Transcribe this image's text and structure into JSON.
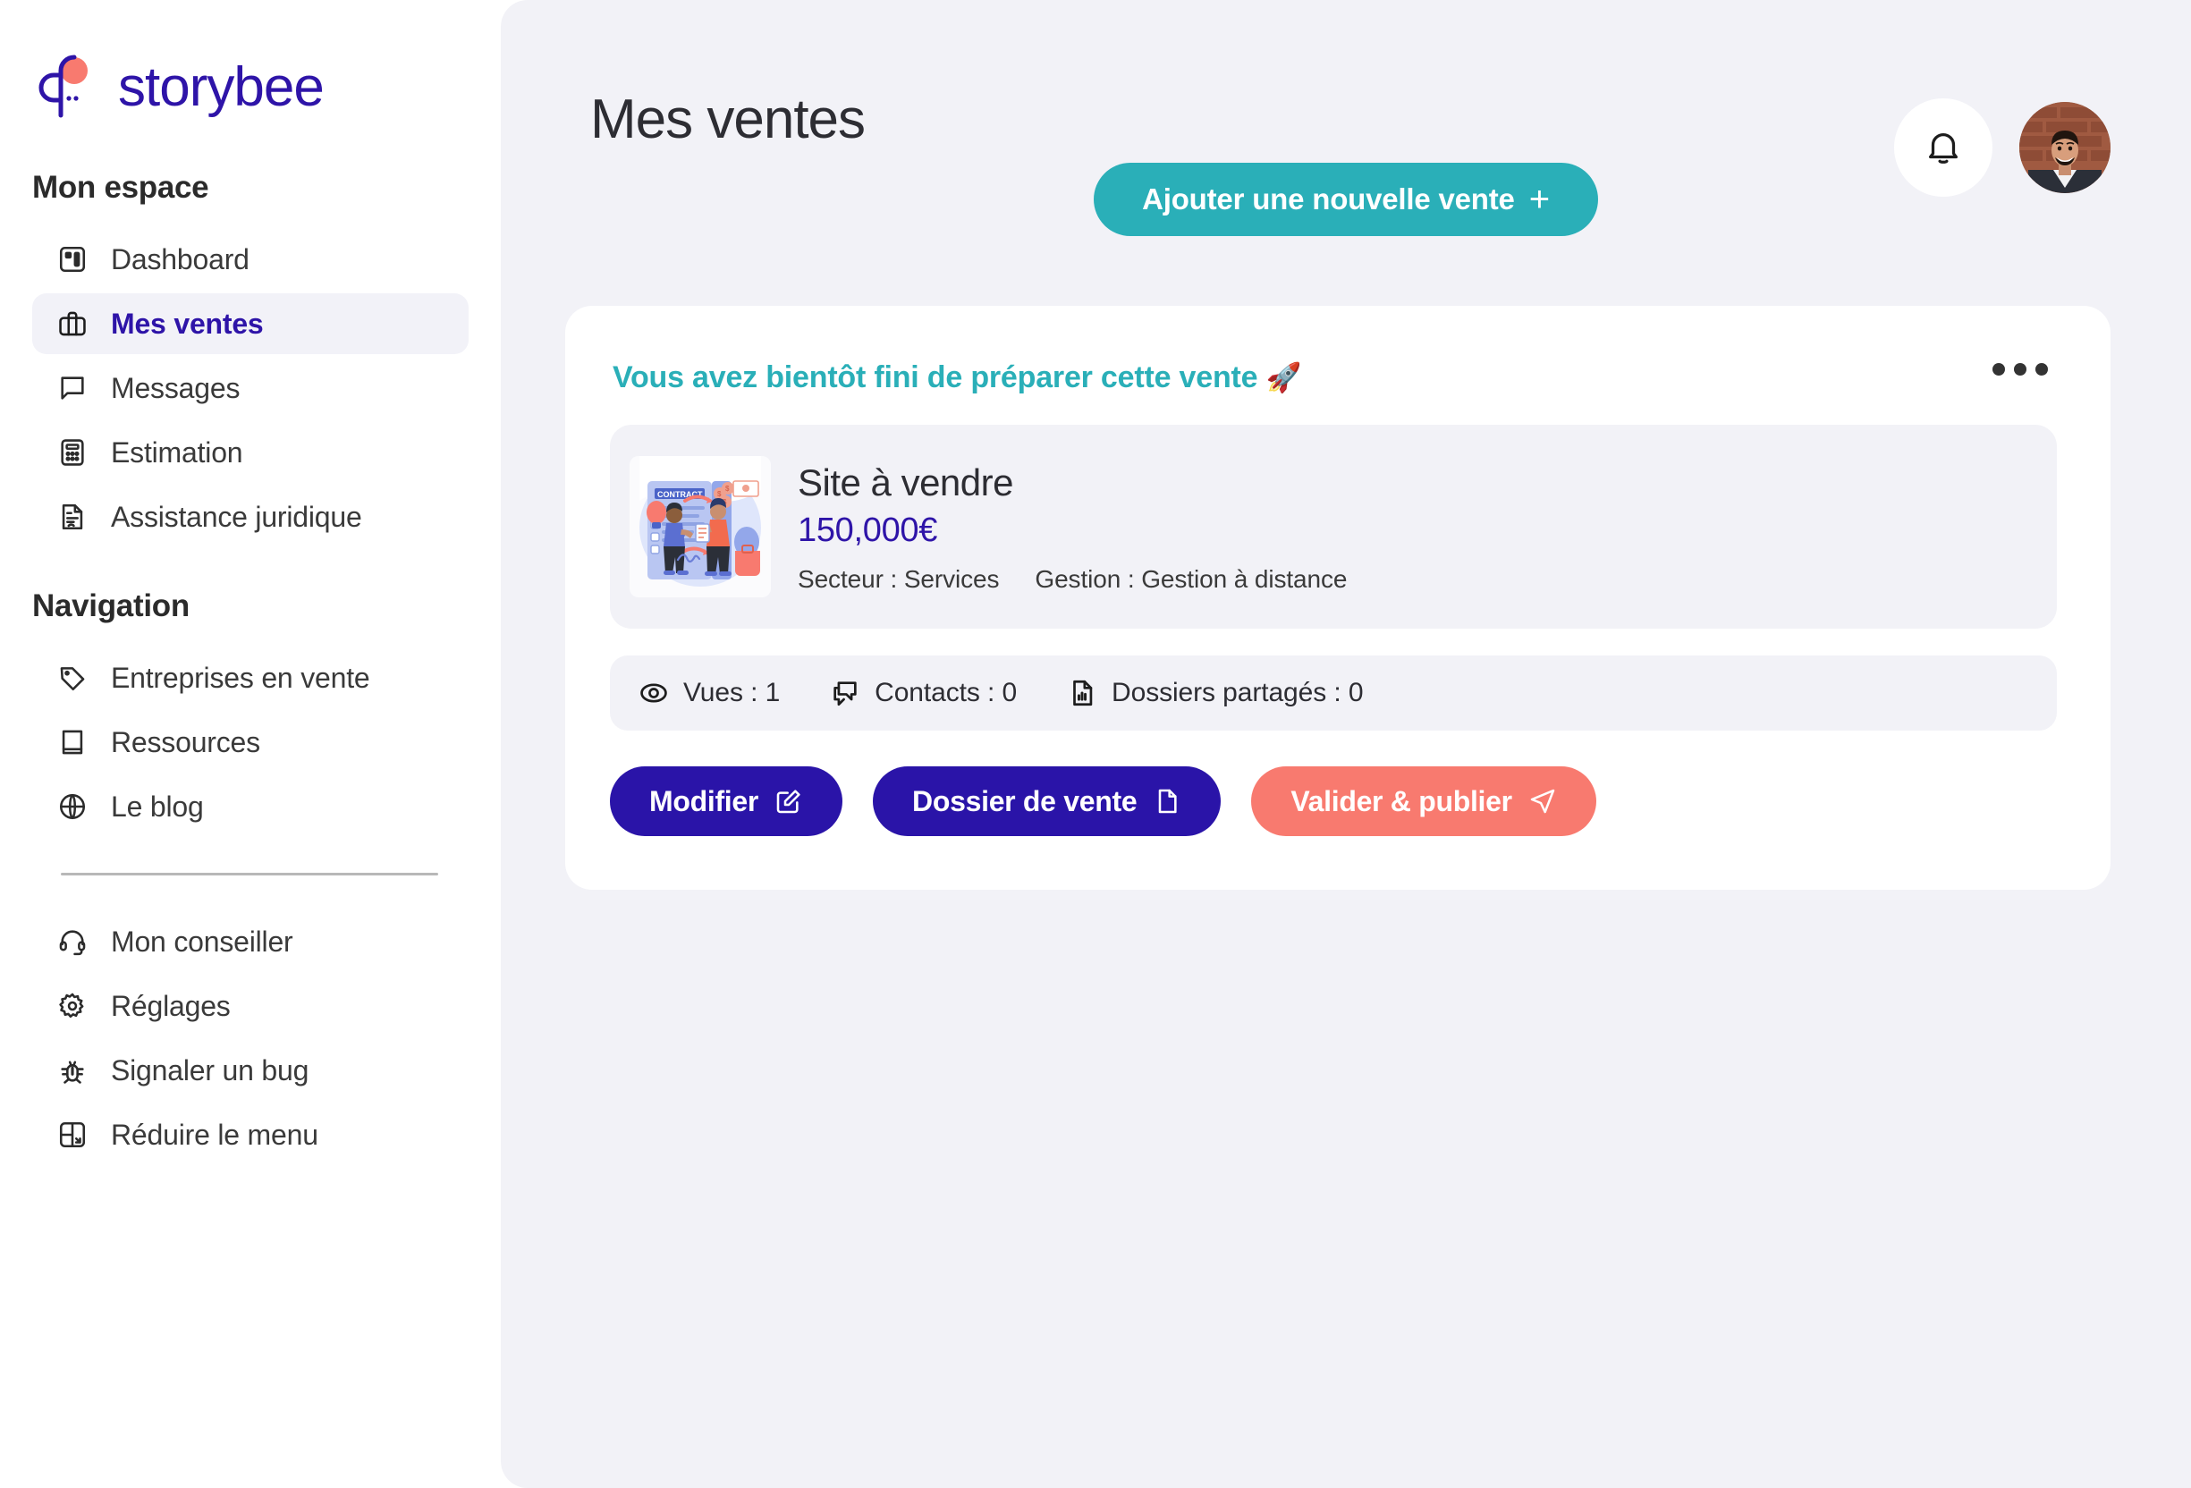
{
  "brand": {
    "name": "storybee",
    "logo_icon": "storybee-logo-icon",
    "accent_purple": "#2e14a8",
    "accent_coral": "#f87a6f",
    "accent_teal": "#2aafb8"
  },
  "sidebar": {
    "sections": [
      {
        "title": "Mon espace",
        "items": [
          {
            "label": "Dashboard",
            "icon": "dashboard-icon",
            "active": false
          },
          {
            "label": "Mes ventes",
            "icon": "briefcase-icon",
            "active": true
          },
          {
            "label": "Messages",
            "icon": "chat-bubble-icon",
            "active": false
          },
          {
            "label": "Estimation",
            "icon": "calculator-icon",
            "active": false
          },
          {
            "label": "Assistance juridique",
            "icon": "legal-document-icon",
            "active": false
          }
        ]
      },
      {
        "title": "Navigation",
        "items": [
          {
            "label": "Entreprises en vente",
            "icon": "tag-icon",
            "active": false
          },
          {
            "label": "Ressources",
            "icon": "book-icon",
            "active": false
          },
          {
            "label": "Le blog",
            "icon": "globe-icon",
            "active": false
          }
        ]
      }
    ],
    "bottom_items": [
      {
        "label": "Mon conseiller",
        "icon": "headset-icon"
      },
      {
        "label": "Réglages",
        "icon": "gear-icon"
      },
      {
        "label": "Signaler un bug",
        "icon": "bug-icon"
      },
      {
        "label": "Réduire le menu",
        "icon": "collapse-menu-icon"
      }
    ]
  },
  "header": {
    "page_title": "Mes ventes",
    "bell_icon": "notification-bell-icon",
    "avatar_icon": "user-avatar"
  },
  "actions_top": {
    "add_sale_label": "Ajouter une nouvelle vente",
    "add_sale_plus": "+"
  },
  "card": {
    "status_message": "Vous avez bientôt fini de préparer cette vente",
    "status_emoji": "🚀",
    "kebab_icon": "more-options-icon",
    "listing": {
      "thumbnail_icon": "contract-illustration",
      "title": "Site à vendre",
      "price": "150,000€",
      "meta": [
        "Secteur : Services",
        "Gestion : Gestion à distance"
      ]
    },
    "stats": [
      {
        "label": "Vues : 1",
        "icon": "eye-icon"
      },
      {
        "label": "Contacts : 0",
        "icon": "chat-icon"
      },
      {
        "label": "Dossiers partagés : 0",
        "icon": "file-chart-icon"
      }
    ],
    "buttons": [
      {
        "label": "Modifier",
        "icon": "edit-icon",
        "style": "primary"
      },
      {
        "label": "Dossier de vente",
        "icon": "file-icon",
        "style": "dossier"
      },
      {
        "label": "Valider & publier",
        "icon": "send-icon",
        "style": "publish"
      }
    ]
  }
}
